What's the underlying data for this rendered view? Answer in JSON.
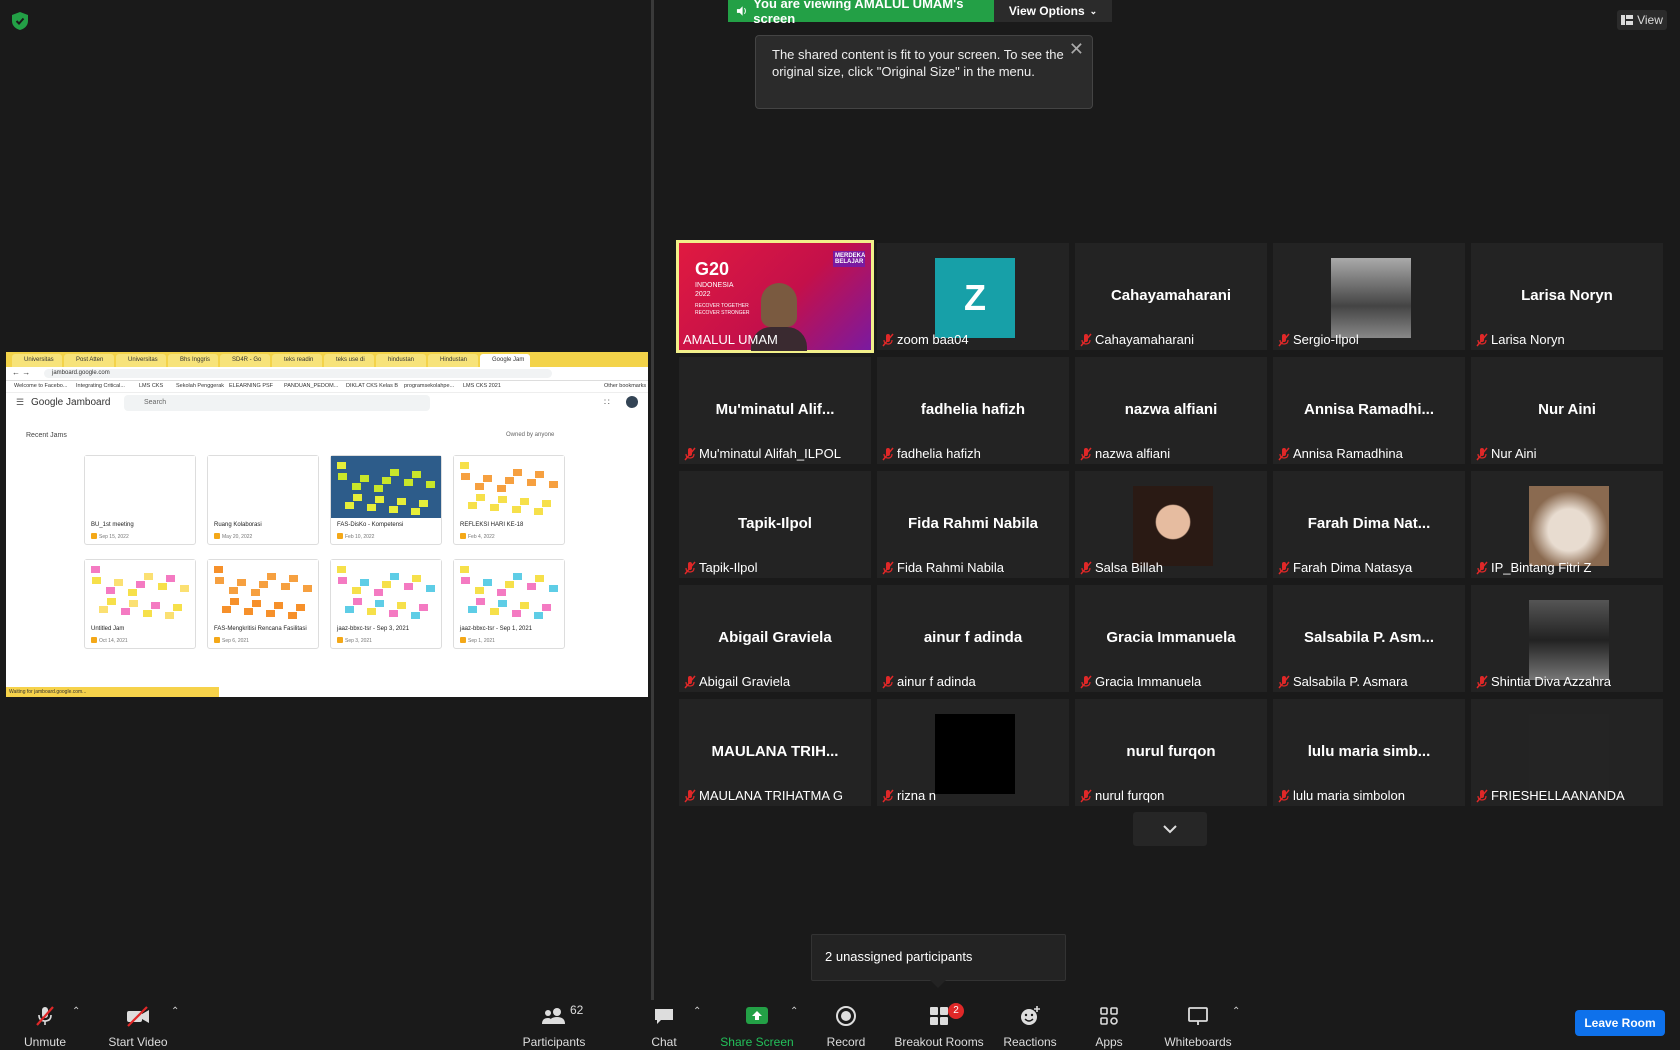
{
  "topbar": {
    "viewing_text": "You are viewing AMALUL UMAM's screen",
    "view_options_label": "View Options",
    "tooltip_text": "The shared content is fit to your screen. To see the original size, click \"Original Size\" in the menu.",
    "view_label": "View"
  },
  "browser": {
    "tabs": [
      "Universitas",
      "Post Atten",
      "Universitas",
      "Bhs Inggris",
      "SD4R - Go",
      "teks readin",
      "teks use di",
      "hindustan",
      "Hindustan",
      "Google Jam"
    ],
    "url": "jamboard.google.com",
    "bookmarks": [
      "Welcome to Facebo...",
      "Integrating Critical...",
      "LMS CKS",
      "Sekolah Penggerak",
      "ELEARNING PSF",
      "PANDUAN_PEDOM...",
      "DIKLAT CKS Kelas B",
      "programsekolahpe...",
      "LMS CKS 2021",
      "Other bookmarks"
    ],
    "status": "Waiting for jamboard.google.com..."
  },
  "jamboard": {
    "logo": "Google Jamboard",
    "search_placeholder": "Search",
    "recent_label": "Recent Jams",
    "owned_label": "Owned by anyone",
    "cards": [
      {
        "title": "BU_1st meeting",
        "date": "Sep 15, 2022"
      },
      {
        "title": "Ruang Kolaborasi",
        "date": "May 20, 2022"
      },
      {
        "title": "FAS-DisKo - Kompetensi",
        "date": "Feb 10, 2022"
      },
      {
        "title": "REFLEKSI HARI KE-18",
        "date": "Feb 4, 2022"
      },
      {
        "title": "Untitled Jam",
        "date": "Oct 14, 2021"
      },
      {
        "title": "FAS-Mengkritisi Rencana Fasilitasi",
        "date": "Sep 6, 2021"
      },
      {
        "title": "jaaz-bbxc-tsr - Sep 3, 2021",
        "date": "Sep 3, 2021"
      },
      {
        "title": "jaaz-bbxc-tsr - Sep 1, 2021",
        "date": "Sep 1, 2021"
      }
    ]
  },
  "gallery": [
    {
      "big": "",
      "label": "AMALUL UMAM",
      "type": "video",
      "muted": false
    },
    {
      "big": "",
      "label": "zoom baa04",
      "type": "letter",
      "letter": "Z",
      "muted": true
    },
    {
      "big": "Cahayamaharani",
      "label": "Cahayamaharani",
      "type": "name",
      "muted": true
    },
    {
      "big": "",
      "label": "Sergio-Ilpol",
      "type": "photo-bw",
      "muted": true
    },
    {
      "big": "Larisa Noryn",
      "label": "Larisa Noryn",
      "type": "name",
      "muted": true
    },
    {
      "big": "Mu'minatul  Alif...",
      "label": "Mu'minatul Alifah_ILPOL",
      "type": "name",
      "muted": true
    },
    {
      "big": "fadhelia hafizh",
      "label": "fadhelia hafizh",
      "type": "name",
      "muted": true
    },
    {
      "big": "nazwa alfiani",
      "label": "nazwa alfiani",
      "type": "name",
      "muted": true
    },
    {
      "big": "Annisa  Ramadhi...",
      "label": "Annisa Ramadhina",
      "type": "name",
      "muted": true
    },
    {
      "big": "Nur Aini",
      "label": "Nur Aini",
      "type": "name",
      "muted": true
    },
    {
      "big": "Tapik-Ilpol",
      "label": "Tapik-Ilpol",
      "type": "name",
      "muted": true
    },
    {
      "big": "Fida Rahmi Nabila",
      "label": "Fida Rahmi Nabila",
      "type": "name",
      "muted": true
    },
    {
      "big": "",
      "label": "Salsa Billah",
      "type": "photo-girl",
      "muted": true
    },
    {
      "big": "Farah Dima Nat...",
      "label": "Farah Dima Natasya",
      "type": "name",
      "muted": true
    },
    {
      "big": "",
      "label": "IP_Bintang Fitri Z",
      "type": "photo-cat",
      "muted": true
    },
    {
      "big": "Abigail Graviela",
      "label": "Abigail Graviela",
      "type": "name",
      "muted": true
    },
    {
      "big": "ainur f adinda",
      "label": "ainur f adinda",
      "type": "name",
      "muted": true
    },
    {
      "big": "Gracia Immanuela",
      "label": "Gracia Immanuela",
      "type": "name",
      "muted": true
    },
    {
      "big": "Salsabila P. Asm...",
      "label": "Salsabila P. Asmara",
      "type": "name",
      "muted": true
    },
    {
      "big": "",
      "label": "Shintia Diva Azzahra",
      "type": "photo-dark",
      "muted": true
    },
    {
      "big": "MAULANA TRIH...",
      "label": "MAULANA TRIHATMA G",
      "type": "name",
      "muted": true
    },
    {
      "big": "",
      "label": "rizna n",
      "type": "photo-black",
      "muted": true
    },
    {
      "big": "nurul furqon",
      "label": "nurul furqon",
      "type": "name",
      "muted": true
    },
    {
      "big": "lulu maria simb...",
      "label": "lulu maria simbolon",
      "type": "name",
      "muted": true
    },
    {
      "big": "",
      "label": "FRIESHELLAANANDA",
      "type": "photo-blank",
      "muted": true
    }
  ],
  "video_overlay": {
    "g20": "G20",
    "country": "INDONESIA",
    "year": "2022",
    "motto": "RECOVER TOGETHER RECOVER STRONGER",
    "badge": "MERDEKA BELAJAR"
  },
  "unassigned_text": "2 unassigned participants",
  "toolbar": {
    "unmute": "Unmute",
    "start_video": "Start Video",
    "participants": "Participants",
    "participants_count": "62",
    "chat": "Chat",
    "share_screen": "Share Screen",
    "record": "Record",
    "breakout_rooms": "Breakout Rooms",
    "breakout_badge": "2",
    "reactions": "Reactions",
    "apps": "Apps",
    "whiteboards": "Whiteboards",
    "leave_room": "Leave Room"
  },
  "colors": {
    "accent_green": "#23a046",
    "leave_blue": "#0e71eb",
    "mute_red": "#e02828",
    "active_speaker": "#f2f08a"
  }
}
